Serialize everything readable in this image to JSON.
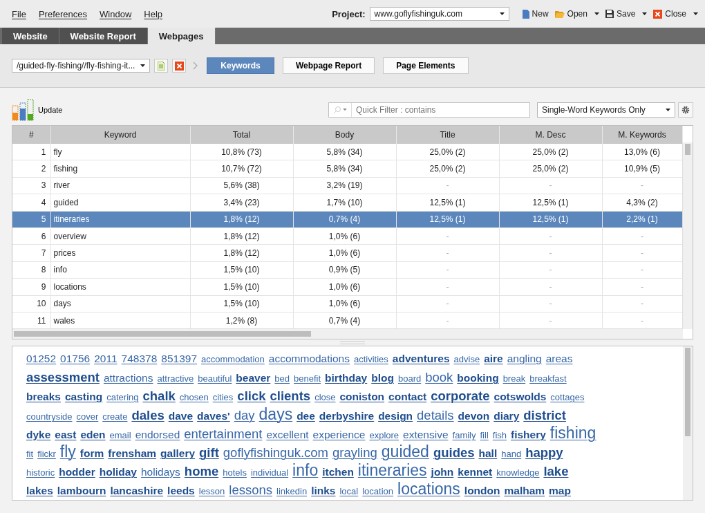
{
  "menu": [
    "File",
    "Preferences",
    "Window",
    "Help"
  ],
  "project": {
    "label": "Project:",
    "value": "www.goflyfishinguk.com"
  },
  "actions": [
    {
      "label": "New",
      "kind": "new",
      "dropdown": false
    },
    {
      "label": "Open",
      "kind": "open",
      "dropdown": true
    },
    {
      "label": "Save",
      "kind": "save",
      "dropdown": true
    },
    {
      "label": "Close",
      "kind": "close",
      "dropdown": true
    }
  ],
  "tabs": [
    {
      "label": "Website",
      "selected": false
    },
    {
      "label": "Website Report",
      "selected": false
    },
    {
      "label": "Webpages",
      "selected": true
    }
  ],
  "page_select": {
    "value": "/guided-fly-fishing//fly-fishing-it..."
  },
  "views": [
    {
      "label": "Keywords",
      "selected": true
    },
    {
      "label": "Webpage Report",
      "selected": false
    },
    {
      "label": "Page Elements",
      "selected": false
    }
  ],
  "update": {
    "label": "Update"
  },
  "filter": {
    "placeholder": "Quick Filter : contains"
  },
  "mode": {
    "value": "Single-Word Keywords Only"
  },
  "table": {
    "columns": [
      "#",
      "Keyword",
      "Total",
      "Body",
      "Title",
      "M. Desc",
      "M. Keywords"
    ],
    "rows": [
      {
        "cells": [
          "1",
          "fly",
          "10,8% (73)",
          "5,8% (34)",
          "25,0% (2)",
          "25,0% (2)",
          "13,0% (6)"
        ],
        "selected": false
      },
      {
        "cells": [
          "2",
          "fishing",
          "10,7% (72)",
          "5,8% (34)",
          "25,0% (2)",
          "25,0% (2)",
          "10,9% (5)"
        ],
        "selected": false
      },
      {
        "cells": [
          "3",
          "river",
          "5,6% (38)",
          "3,2% (19)",
          "-",
          "-",
          "-"
        ],
        "selected": false
      },
      {
        "cells": [
          "4",
          "guided",
          "3,4% (23)",
          "1,7% (10)",
          "12,5% (1)",
          "12,5% (1)",
          "4,3% (2)"
        ],
        "selected": false
      },
      {
        "cells": [
          "5",
          "itineraries",
          "1,8% (12)",
          "0,7% (4)",
          "12,5% (1)",
          "12,5% (1)",
          "2,2% (1)"
        ],
        "selected": true
      },
      {
        "cells": [
          "6",
          "overview",
          "1,8% (12)",
          "1,0% (6)",
          "-",
          "-",
          "-"
        ],
        "selected": false
      },
      {
        "cells": [
          "7",
          "prices",
          "1,8% (12)",
          "1,0% (6)",
          "-",
          "-",
          "-"
        ],
        "selected": false
      },
      {
        "cells": [
          "8",
          "info",
          "1,5% (10)",
          "0,9% (5)",
          "-",
          "-",
          "-"
        ],
        "selected": false
      },
      {
        "cells": [
          "9",
          "locations",
          "1,5% (10)",
          "1,0% (6)",
          "-",
          "-",
          "-"
        ],
        "selected": false
      },
      {
        "cells": [
          "10",
          "days",
          "1,5% (10)",
          "1,0% (6)",
          "-",
          "-",
          "-"
        ],
        "selected": false
      },
      {
        "cells": [
          "11",
          "wales",
          "1,2% (8)",
          "0,7% (4)",
          "-",
          "-",
          "-"
        ],
        "selected": false
      }
    ]
  },
  "cloud_rows": [
    [
      {
        "text": "01252",
        "kind": "medium",
        "bold": false
      },
      {
        "text": "01756",
        "kind": "medium",
        "bold": false
      },
      {
        "text": "2011",
        "kind": "medium",
        "bold": false
      },
      {
        "text": "748378",
        "kind": "medium",
        "bold": false
      },
      {
        "text": "851397",
        "kind": "medium",
        "bold": false
      },
      {
        "text": "accommodation",
        "kind": "small",
        "bold": false
      },
      {
        "text": "accommodations",
        "kind": "medium",
        "bold": false
      },
      {
        "text": "activities",
        "kind": "small",
        "bold": false
      },
      {
        "text": "adventures",
        "kind": "medium",
        "bold": true
      },
      {
        "text": "advise",
        "kind": "small",
        "bold": false
      },
      {
        "text": "aire",
        "kind": "medium",
        "bold": true
      },
      {
        "text": "angling",
        "kind": "medium",
        "bold": false
      },
      {
        "text": "areas",
        "kind": "medium",
        "bold": false
      }
    ],
    [
      {
        "text": "assessment",
        "kind": "large",
        "bold": true
      },
      {
        "text": "attractions",
        "kind": "medium",
        "bold": false
      },
      {
        "text": "attractive",
        "kind": "small",
        "bold": false
      },
      {
        "text": "beautiful",
        "kind": "small",
        "bold": false
      },
      {
        "text": "beaver",
        "kind": "medium",
        "bold": true
      },
      {
        "text": "bed",
        "kind": "small",
        "bold": false
      },
      {
        "text": "benefit",
        "kind": "small",
        "bold": false
      },
      {
        "text": "birthday",
        "kind": "medium",
        "bold": true
      },
      {
        "text": "blog",
        "kind": "medium",
        "bold": true
      },
      {
        "text": "board",
        "kind": "small",
        "bold": false
      },
      {
        "text": "book",
        "kind": "large",
        "bold": false
      },
      {
        "text": "booking",
        "kind": "medium",
        "bold": true
      },
      {
        "text": "break",
        "kind": "small",
        "bold": false
      },
      {
        "text": "breakfast",
        "kind": "small",
        "bold": false
      }
    ],
    [
      {
        "text": "breaks",
        "kind": "medium",
        "bold": true
      },
      {
        "text": "casting",
        "kind": "medium",
        "bold": true
      },
      {
        "text": "catering",
        "kind": "small",
        "bold": false
      },
      {
        "text": "chalk",
        "kind": "large",
        "bold": true
      },
      {
        "text": "chosen",
        "kind": "small",
        "bold": false
      },
      {
        "text": "cities",
        "kind": "small",
        "bold": false
      },
      {
        "text": "click",
        "kind": "large",
        "bold": true
      },
      {
        "text": "clients",
        "kind": "large",
        "bold": true
      },
      {
        "text": "close",
        "kind": "small",
        "bold": false
      },
      {
        "text": "coniston",
        "kind": "medium",
        "bold": true
      },
      {
        "text": "contact",
        "kind": "medium",
        "bold": true
      },
      {
        "text": "corporate",
        "kind": "large",
        "bold": true
      },
      {
        "text": "cotswolds",
        "kind": "medium",
        "bold": true
      },
      {
        "text": "cottages",
        "kind": "small",
        "bold": false
      }
    ],
    [
      {
        "text": "countryside",
        "kind": "small",
        "bold": false
      },
      {
        "text": "cover",
        "kind": "small",
        "bold": false
      },
      {
        "text": "create",
        "kind": "small",
        "bold": false
      },
      {
        "text": "dales",
        "kind": "large",
        "bold": true
      },
      {
        "text": "dave",
        "kind": "medium",
        "bold": true
      },
      {
        "text": "daves'",
        "kind": "medium",
        "bold": true
      },
      {
        "text": "day",
        "kind": "large",
        "bold": false
      },
      {
        "text": "days",
        "kind": "huge",
        "bold": false
      },
      {
        "text": "dee",
        "kind": "medium",
        "bold": true
      },
      {
        "text": "derbyshire",
        "kind": "medium",
        "bold": true
      },
      {
        "text": "design",
        "kind": "medium",
        "bold": true
      },
      {
        "text": "details",
        "kind": "large",
        "bold": false
      },
      {
        "text": "devon",
        "kind": "medium",
        "bold": true
      },
      {
        "text": "diary",
        "kind": "medium",
        "bold": true
      },
      {
        "text": "district",
        "kind": "large",
        "bold": true
      }
    ],
    [
      {
        "text": "dyke",
        "kind": "medium",
        "bold": true
      },
      {
        "text": "east",
        "kind": "medium",
        "bold": true
      },
      {
        "text": "eden",
        "kind": "medium",
        "bold": true
      },
      {
        "text": "email",
        "kind": "small",
        "bold": false
      },
      {
        "text": "endorsed",
        "kind": "medium",
        "bold": false
      },
      {
        "text": "entertainment",
        "kind": "large",
        "bold": false
      },
      {
        "text": "excellent",
        "kind": "medium",
        "bold": false
      },
      {
        "text": "experience",
        "kind": "medium",
        "bold": false
      },
      {
        "text": "explore",
        "kind": "small",
        "bold": false
      },
      {
        "text": "extensive",
        "kind": "medium",
        "bold": false
      },
      {
        "text": "family",
        "kind": "small",
        "bold": false
      },
      {
        "text": "fill",
        "kind": "small",
        "bold": false
      },
      {
        "text": "fish",
        "kind": "small",
        "bold": false
      },
      {
        "text": "fishery",
        "kind": "medium",
        "bold": true
      },
      {
        "text": "fishing",
        "kind": "huge",
        "bold": false
      }
    ],
    [
      {
        "text": "fit",
        "kind": "small",
        "bold": false
      },
      {
        "text": "flickr",
        "kind": "small",
        "bold": false
      },
      {
        "text": "fly",
        "kind": "huge",
        "bold": false
      },
      {
        "text": "form",
        "kind": "medium",
        "bold": true
      },
      {
        "text": "frensham",
        "kind": "medium",
        "bold": true
      },
      {
        "text": "gallery",
        "kind": "medium",
        "bold": true
      },
      {
        "text": "gift",
        "kind": "large",
        "bold": true
      },
      {
        "text": "goflyfishinguk.com",
        "kind": "large",
        "bold": false
      },
      {
        "text": "grayling",
        "kind": "large",
        "bold": false
      },
      {
        "text": "guided",
        "kind": "huge",
        "bold": false
      },
      {
        "text": "guides",
        "kind": "large",
        "bold": true
      },
      {
        "text": "hall",
        "kind": "medium",
        "bold": true
      },
      {
        "text": "hand",
        "kind": "small",
        "bold": false
      },
      {
        "text": "happy",
        "kind": "large",
        "bold": true
      }
    ],
    [
      {
        "text": "historic",
        "kind": "small",
        "bold": false
      },
      {
        "text": "hodder",
        "kind": "medium",
        "bold": true
      },
      {
        "text": "holiday",
        "kind": "medium",
        "bold": true
      },
      {
        "text": "holidays",
        "kind": "medium",
        "bold": false
      },
      {
        "text": "home",
        "kind": "large",
        "bold": true
      },
      {
        "text": "hotels",
        "kind": "small",
        "bold": false
      },
      {
        "text": "individual",
        "kind": "small",
        "bold": false
      },
      {
        "text": "info",
        "kind": "huge",
        "bold": false
      },
      {
        "text": "itchen",
        "kind": "medium",
        "bold": true
      },
      {
        "text": "itineraries",
        "kind": "huge",
        "bold": false
      },
      {
        "text": "john",
        "kind": "medium",
        "bold": true
      },
      {
        "text": "kennet",
        "kind": "medium",
        "bold": true
      },
      {
        "text": "knowledge",
        "kind": "small",
        "bold": false
      },
      {
        "text": "lake",
        "kind": "large",
        "bold": true
      }
    ],
    [
      {
        "text": "lakes",
        "kind": "medium",
        "bold": true
      },
      {
        "text": "lambourn",
        "kind": "medium",
        "bold": true
      },
      {
        "text": "lancashire",
        "kind": "medium",
        "bold": true
      },
      {
        "text": "leeds",
        "kind": "medium",
        "bold": true
      },
      {
        "text": "lesson",
        "kind": "small",
        "bold": false
      },
      {
        "text": "lessons",
        "kind": "large",
        "bold": false
      },
      {
        "text": "linkedin",
        "kind": "small",
        "bold": false
      },
      {
        "text": "links",
        "kind": "medium",
        "bold": true
      },
      {
        "text": "local",
        "kind": "small",
        "bold": false
      },
      {
        "text": "location",
        "kind": "small",
        "bold": false
      },
      {
        "text": "locations",
        "kind": "huge",
        "bold": false
      },
      {
        "text": "london",
        "kind": "medium",
        "bold": true
      },
      {
        "text": "malham",
        "kind": "medium",
        "bold": true
      },
      {
        "text": "map",
        "kind": "medium",
        "bold": true
      }
    ]
  ]
}
